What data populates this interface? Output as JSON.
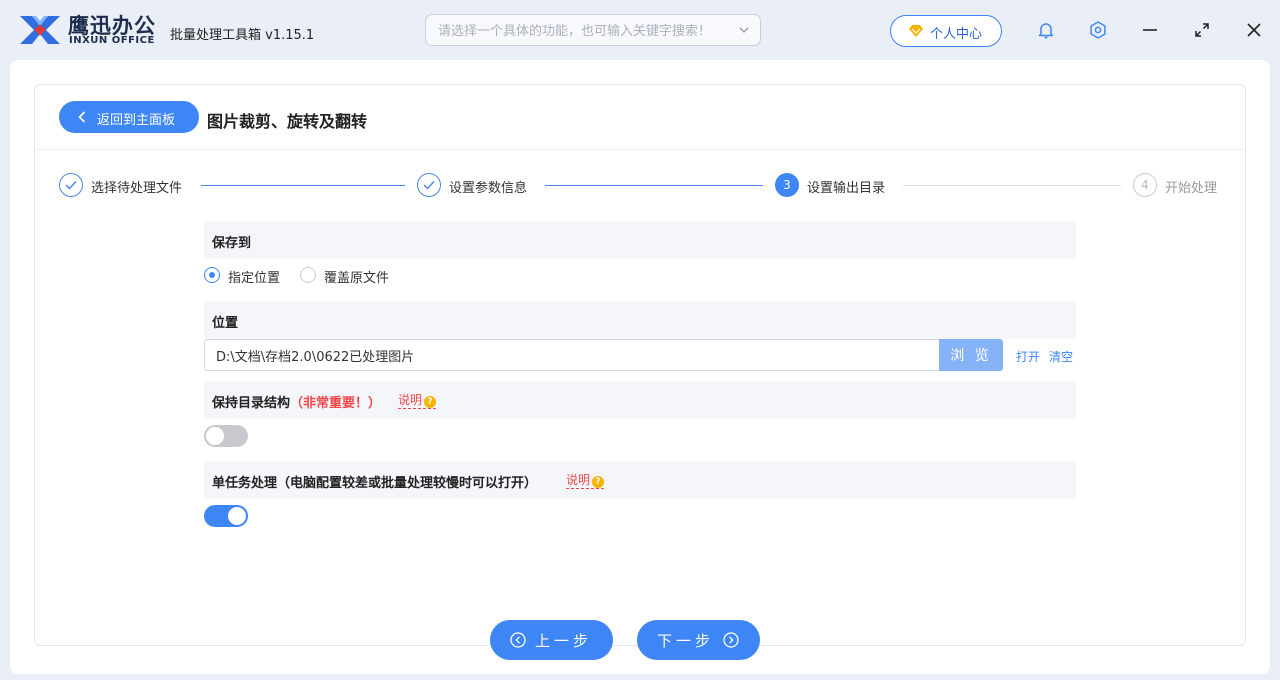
{
  "app": {
    "brand_cn": "鹰迅办公",
    "brand_en": "INXUN OFFICE",
    "name": "批量处理工具箱 v1.15.1"
  },
  "search": {
    "placeholder": "请选择一个具体的功能，也可输入关键字搜索！"
  },
  "user_center": {
    "label": "个人中心"
  },
  "window_controls": {
    "icons": [
      "bell-icon",
      "gear-icon",
      "minimize-icon",
      "maximize-icon",
      "close-icon"
    ]
  },
  "header": {
    "back_label": "返回到主面板",
    "title": "图片裁剪、旋转及翻转"
  },
  "steps": [
    {
      "label": "选择待处理文件",
      "state": "done"
    },
    {
      "label": "设置参数信息",
      "state": "done"
    },
    {
      "label": "设置输出目录",
      "number": "3",
      "state": "active"
    },
    {
      "label": "开始处理",
      "number": "4",
      "state": "todo"
    }
  ],
  "save_to": {
    "heading": "保存到",
    "options": [
      "指定位置",
      "覆盖原文件"
    ],
    "selected": "指定位置"
  },
  "location": {
    "heading": "位置",
    "value": "D:\\文档\\存档2.0\\0622已处理图片",
    "browse_label": "浏 览",
    "open_label": "打开",
    "clear_label": "清空"
  },
  "keep_structure": {
    "heading": "保持目录结构",
    "warning": "（非常重要！）",
    "explain_label": "说明",
    "enabled": false
  },
  "single_task": {
    "heading": "单任务处理（电脑配置较差或批量处理较慢时可以打开）",
    "explain_label": "说明",
    "enabled": true
  },
  "nav": {
    "prev_label": "上一步",
    "next_label": "下一步"
  },
  "colors": {
    "accent": "#3e86f5",
    "warning": "#f04848",
    "help_badge": "#f5b400"
  }
}
